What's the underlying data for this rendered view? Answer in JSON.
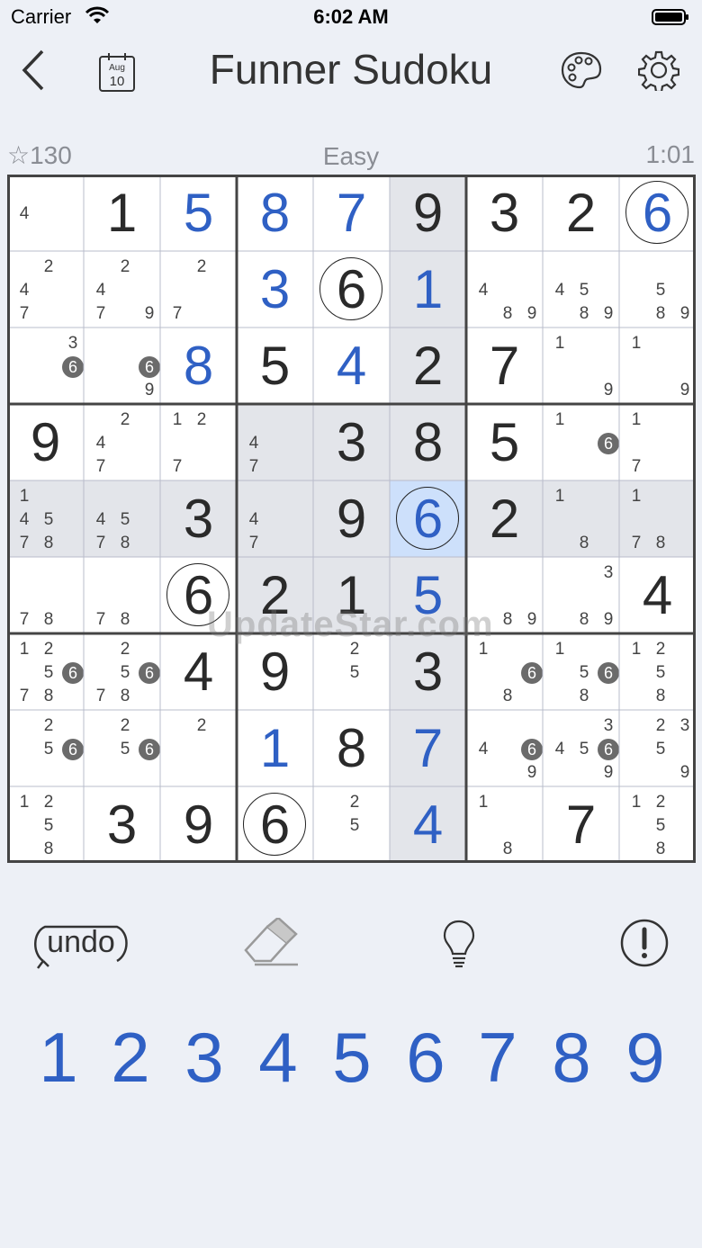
{
  "status_bar": {
    "carrier": "Carrier",
    "time": "6:02 AM"
  },
  "nav": {
    "title": "Funner Sudoku",
    "calendar_month": "Aug",
    "calendar_day": "10"
  },
  "info": {
    "score": "☆130",
    "difficulty": "Easy",
    "timer": "1:01"
  },
  "board": [
    [
      {
        "n": [
          "4"
        ]
      },
      {
        "v": "1",
        "k": "given"
      },
      {
        "v": "5",
        "k": "user"
      },
      {
        "v": "8",
        "k": "user"
      },
      {
        "v": "7",
        "k": "user"
      },
      {
        "v": "9",
        "k": "given",
        "shade": true
      },
      {
        "v": "3",
        "k": "given"
      },
      {
        "v": "2",
        "k": "given"
      },
      {
        "v": "6",
        "k": "user",
        "ring": true
      }
    ],
    [
      {
        "n": [
          "2",
          "4",
          "7"
        ]
      },
      {
        "n": [
          "2",
          "4",
          "7",
          "9"
        ]
      },
      {
        "n": [
          "2",
          "7"
        ]
      },
      {
        "v": "3",
        "k": "user"
      },
      {
        "v": "6",
        "k": "given",
        "ring": true
      },
      {
        "v": "1",
        "k": "user",
        "shade": true
      },
      {
        "n": [
          "4",
          "8",
          "9"
        ]
      },
      {
        "n": [
          "4",
          "5",
          "8",
          "9"
        ]
      },
      {
        "n": [
          "5",
          "8",
          "9"
        ]
      }
    ],
    [
      {
        "n": [
          "3",
          "6"
        ]
      },
      {
        "n": [
          "6",
          "9"
        ]
      },
      {
        "v": "8",
        "k": "user"
      },
      {
        "v": "5",
        "k": "given"
      },
      {
        "v": "4",
        "k": "user"
      },
      {
        "v": "2",
        "k": "given",
        "shade": true
      },
      {
        "v": "7",
        "k": "given"
      },
      {
        "n": [
          "1",
          "9"
        ]
      },
      {
        "n": [
          "1",
          "9"
        ]
      }
    ],
    [
      {
        "v": "9",
        "k": "given"
      },
      {
        "n": [
          "2",
          "4",
          "7"
        ]
      },
      {
        "n": [
          "1",
          "2",
          "7"
        ]
      },
      {
        "n": [
          "4",
          "7"
        ],
        "shade": true
      },
      {
        "v": "3",
        "k": "given",
        "shade": true
      },
      {
        "v": "8",
        "k": "given",
        "shade": true
      },
      {
        "v": "5",
        "k": "given"
      },
      {
        "n": [
          "1",
          "6"
        ]
      },
      {
        "n": [
          "1",
          "7"
        ]
      }
    ],
    [
      {
        "n": [
          "1",
          "4",
          "5",
          "7",
          "8"
        ],
        "shade": true
      },
      {
        "n": [
          "4",
          "5",
          "7",
          "8"
        ],
        "shade": true
      },
      {
        "v": "3",
        "k": "given",
        "shade": true
      },
      {
        "n": [
          "4",
          "7"
        ],
        "shade": true
      },
      {
        "v": "9",
        "k": "given",
        "shade": true
      },
      {
        "v": "6",
        "k": "user",
        "ring": true,
        "sel": true
      },
      {
        "v": "2",
        "k": "given",
        "shade": true
      },
      {
        "n": [
          "1",
          "8"
        ],
        "shade": true
      },
      {
        "n": [
          "1",
          "7",
          "8"
        ],
        "shade": true
      }
    ],
    [
      {
        "n": [
          "7",
          "8"
        ]
      },
      {
        "n": [
          "7",
          "8"
        ]
      },
      {
        "v": "6",
        "k": "given",
        "ring": true
      },
      {
        "v": "2",
        "k": "given",
        "shade": true
      },
      {
        "v": "1",
        "k": "given",
        "shade": true
      },
      {
        "v": "5",
        "k": "user",
        "shade": true
      },
      {
        "n": [
          "8",
          "9"
        ]
      },
      {
        "n": [
          "3",
          "8",
          "9"
        ]
      },
      {
        "v": "4",
        "k": "given"
      }
    ],
    [
      {
        "n": [
          "1",
          "2",
          "5",
          "6",
          "7",
          "8"
        ]
      },
      {
        "n": [
          "2",
          "5",
          "6",
          "7",
          "8"
        ]
      },
      {
        "v": "4",
        "k": "given"
      },
      {
        "v": "9",
        "k": "given"
      },
      {
        "n": [
          "2",
          "5"
        ]
      },
      {
        "v": "3",
        "k": "given",
        "shade": true
      },
      {
        "n": [
          "1",
          "6",
          "8"
        ]
      },
      {
        "n": [
          "1",
          "5",
          "6",
          "8"
        ]
      },
      {
        "n": [
          "1",
          "2",
          "5",
          "8"
        ]
      }
    ],
    [
      {
        "n": [
          "2",
          "5",
          "6"
        ]
      },
      {
        "n": [
          "2",
          "5",
          "6"
        ]
      },
      {
        "n": [
          "2"
        ]
      },
      {
        "v": "1",
        "k": "user"
      },
      {
        "v": "8",
        "k": "given"
      },
      {
        "v": "7",
        "k": "user",
        "shade": true
      },
      {
        "n": [
          "4",
          "6",
          "9"
        ]
      },
      {
        "n": [
          "3",
          "4",
          "5",
          "6",
          "9"
        ]
      },
      {
        "n": [
          "2",
          "3",
          "5",
          "9"
        ]
      }
    ],
    [
      {
        "n": [
          "1",
          "2",
          "5",
          "8"
        ]
      },
      {
        "v": "3",
        "k": "given"
      },
      {
        "v": "9",
        "k": "given"
      },
      {
        "v": "6",
        "k": "given",
        "ring": true
      },
      {
        "n": [
          "2",
          "5"
        ]
      },
      {
        "v": "4",
        "k": "user",
        "shade": true
      },
      {
        "n": [
          "1",
          "8"
        ]
      },
      {
        "v": "7",
        "k": "given"
      },
      {
        "n": [
          "1",
          "2",
          "5",
          "8"
        ]
      }
    ]
  ],
  "tools": {
    "undo": "undo"
  },
  "numpad": [
    "1",
    "2",
    "3",
    "4",
    "5",
    "6",
    "7",
    "8",
    "9"
  ],
  "watermark": "UpdateStar.com",
  "colors": {
    "accent": "#2f60c4",
    "selected": "#cde0fb",
    "shade": "#e3e5ea"
  }
}
